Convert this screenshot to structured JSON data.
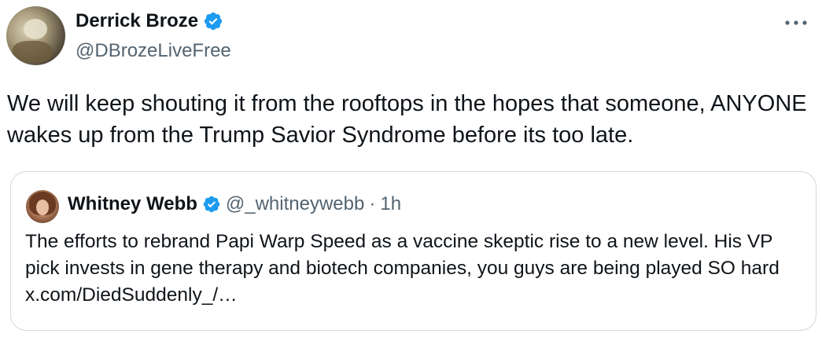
{
  "author": {
    "display_name": "Derrick Broze",
    "handle": "@DBrozeLiveFree",
    "verified": true,
    "avatar": "profile-photo"
  },
  "menu": {
    "more_icon": "more-horizontal-icon",
    "more_glyph": "•••"
  },
  "tweet": {
    "text": "We will keep shouting it from the rooftops in the hopes that someone, ANYONE wakes up from the Trump Savior Syndrome before its too late."
  },
  "quoted_tweet": {
    "display_name": "Whitney Webb",
    "handle": "@_whitneywebb",
    "separator": "·",
    "time": "1h",
    "verified": true,
    "avatar": "profile-photo",
    "text": "The efforts to rebrand Papi Warp Speed as a vaccine skeptic rise to a new level. His VP pick invests in gene therapy and biotech companies, you guys are being played SO hard x.com/DiedSuddenly_/…"
  },
  "colors": {
    "verified_blue": "#1d9bf0",
    "text_primary": "#0f1419",
    "text_secondary": "#536471",
    "border": "#cfd9de"
  }
}
